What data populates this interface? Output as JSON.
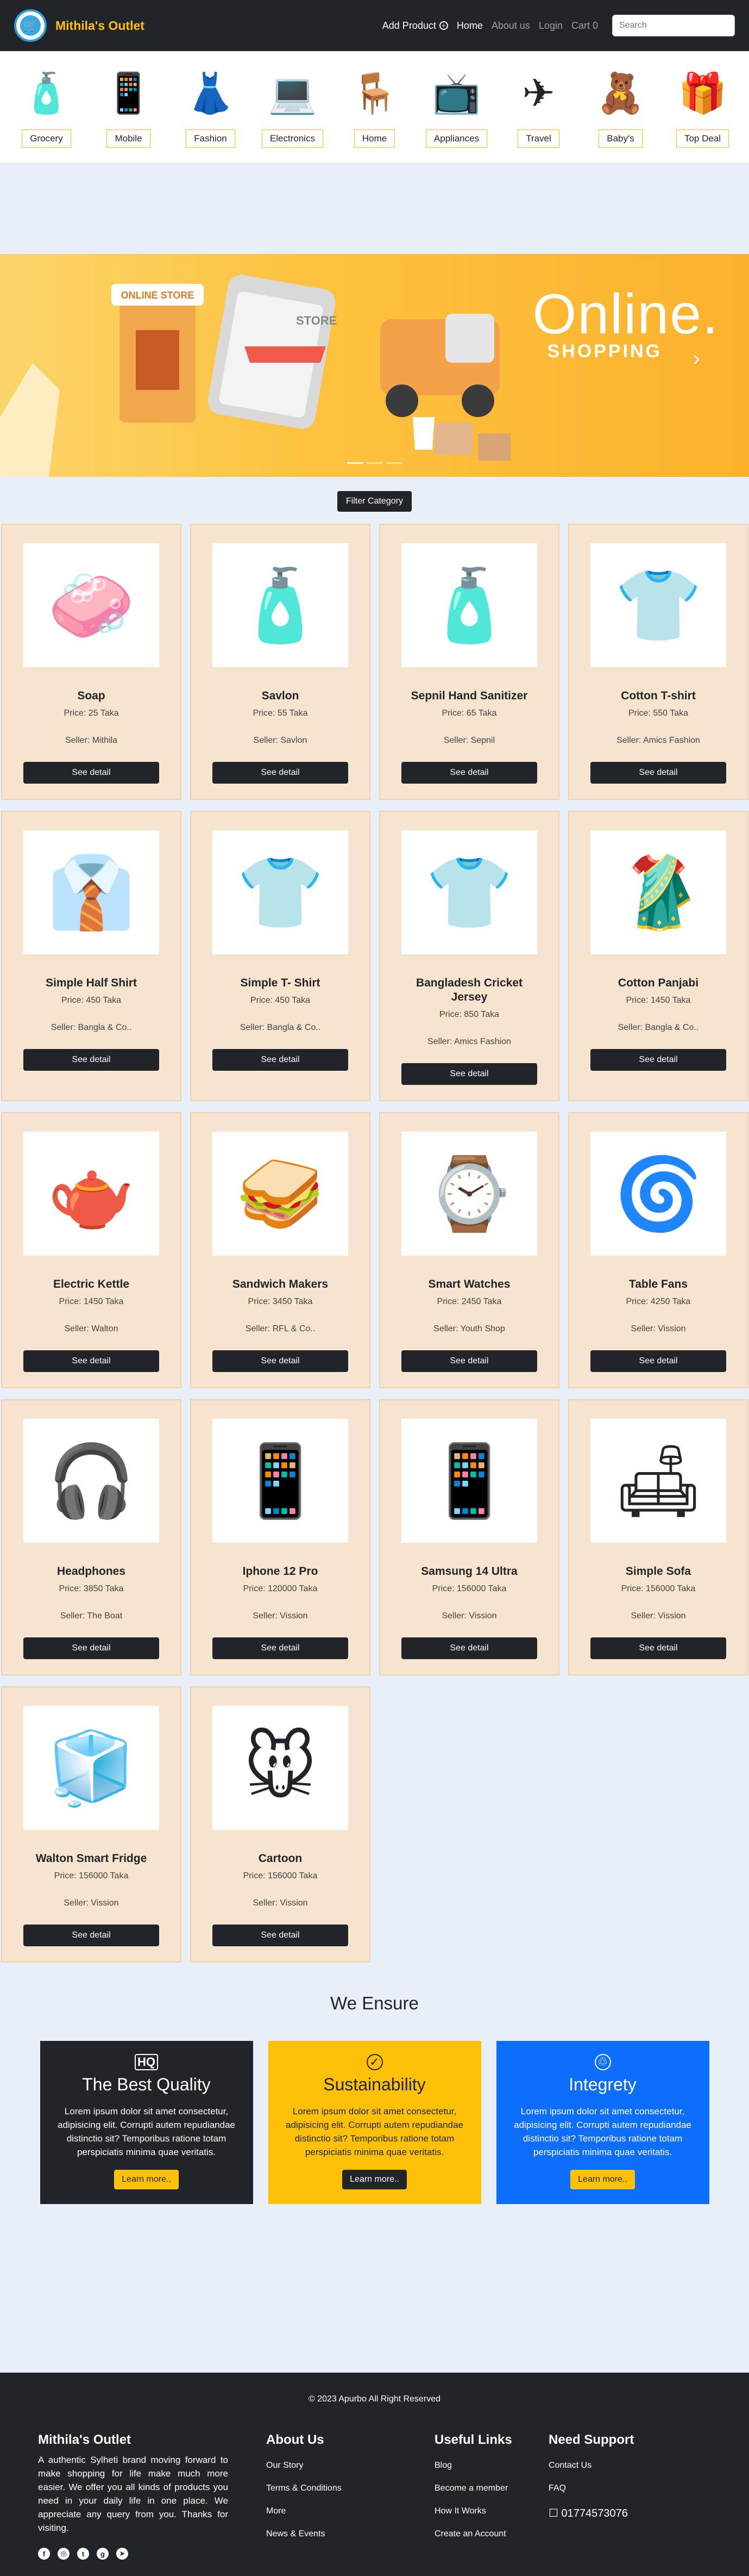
{
  "nav": {
    "brand": "Mithila's Outlet",
    "add_product": "Add Product",
    "links": [
      "Home",
      "About us",
      "Login"
    ],
    "cart": "Cart 0",
    "search_placeholder": "Search"
  },
  "categories": [
    "Grocery",
    "Mobile",
    "Fashion",
    "Electronics",
    "Home",
    "Appliances",
    "Travel",
    "Baby's",
    "Top Deal"
  ],
  "banner": {
    "title": "Online.",
    "subtitle": "SHOPPING",
    "store_sign": "ONLINE STORE",
    "store_sign2": "STORE"
  },
  "filter_label": "Filter Category",
  "products": [
    {
      "name": "Soap",
      "price": "Price: 25 Taka",
      "seller": "Seller: Mithila",
      "icon": "soap-icon"
    },
    {
      "name": "Savlon",
      "price": "Price: 55 Taka",
      "seller": "Seller: Savlon",
      "icon": "antiseptic-bottle-icon"
    },
    {
      "name": "Sepnil Hand Sanitizer",
      "price": "Price: 65 Taka",
      "seller": "Seller: Sepnil",
      "icon": "sanitizer-icon"
    },
    {
      "name": "Cotton T-shirt",
      "price": "Price: 550 Taka",
      "seller": "Seller: Amics Fashion",
      "icon": "tshirt-icon"
    },
    {
      "name": "Simple Half Shirt",
      "price": "Price: 450 Taka",
      "seller": "Seller: Bangla & Co..",
      "icon": "shirt-icon"
    },
    {
      "name": "Simple T- Shirt",
      "price": "Price: 450 Taka",
      "seller": "Seller: Bangla & Co..",
      "icon": "tshirt-icon"
    },
    {
      "name": "Bangladesh Cricket Jersey",
      "price": "Price: 850 Taka",
      "seller": "Seller: Amics Fashion",
      "icon": "jersey-icon"
    },
    {
      "name": "Cotton Panjabi",
      "price": "Price: 1450 Taka",
      "seller": "Seller: Bangla & Co..",
      "icon": "panjabi-icon"
    },
    {
      "name": "Electric Kettle",
      "price": "Price: 1450 Taka",
      "seller": "Seller: Walton",
      "icon": "kettle-icon"
    },
    {
      "name": "Sandwich Makers",
      "price": "Price: 3450 Taka",
      "seller": "Seller: RFL & Co..",
      "icon": "sandwich-maker-icon"
    },
    {
      "name": "Smart Watches",
      "price": "Price: 2450 Taka",
      "seller": "Seller: Youth Shop",
      "icon": "watch-icon"
    },
    {
      "name": "Table Fans",
      "price": "Price: 4250 Taka",
      "seller": "Seller: Vission",
      "icon": "fan-icon"
    },
    {
      "name": "Headphones",
      "price": "Price: 3850 Taka",
      "seller": "Seller: The Boat",
      "icon": "headphones-icon"
    },
    {
      "name": "Iphone 12 Pro",
      "price": "Price: 120000 Taka",
      "seller": "Seller: Vission",
      "icon": "phone-icon"
    },
    {
      "name": "Samsung 14 Ultra",
      "price": "Price: 156000 Taka",
      "seller": "Seller: Vission",
      "icon": "phone-icon"
    },
    {
      "name": "Simple Sofa",
      "price": "Price: 156000 Taka",
      "seller": "Seller: Vission",
      "icon": "sofa-icon"
    },
    {
      "name": "Walton Smart Fridge",
      "price": "Price: 156000 Taka",
      "seller": "Seller: Vission",
      "icon": "fridge-icon"
    },
    {
      "name": "Cartoon",
      "price": "Price: 156000 Taka",
      "seller": "Seller: Vission",
      "icon": "cartoon-icon"
    }
  ],
  "detail_label": "See detail",
  "ensure": {
    "title": "We Ensure",
    "cards": [
      {
        "title": "The Best Quality",
        "text": "Lorem ipsum dolor sit amet consectetur, adipisicing elit. Corrupti autem repudiandae distinctio sit? Temporibus ratione totam perspiciatis minima quae veritatis.",
        "button": "Learn more..",
        "icon": "hq-icon",
        "bg": "#212529",
        "fg": "#ffffff",
        "btn_bg": "#ffc107",
        "btn_fg": "#212529"
      },
      {
        "title": "Sustainability",
        "text": "Lorem ipsum dolor sit amet consectetur, adipisicing elit. Corrupti autem repudiandae distinctio sit? Temporibus ratione totam perspiciatis minima quae veritatis.",
        "button": "Learn more..",
        "icon": "check-circle-icon",
        "bg": "#ffc107",
        "fg": "#212529",
        "btn_bg": "#212529",
        "btn_fg": "#ffffff"
      },
      {
        "title": "Integrety",
        "text": "Lorem ipsum dolor sit amet consectetur, adipisicing elit. Corrupti autem repudiandae distinctio sit? Temporibus ratione totam perspiciatis minima quae veritatis.",
        "button": "Learn more..",
        "icon": "recycle-icon",
        "bg": "#0d6efd",
        "fg": "#ffffff",
        "btn_bg": "#ffc107",
        "btn_fg": "#212529"
      }
    ]
  },
  "footer": {
    "copyright": "© 2023 Apurbo All Right Reserved",
    "brand": "Mithila's Outlet",
    "about": "A authentic Sylheti brand moving forward to make shopping for life make much more easier. We offer you all kinds of products you need in your daily life in one place. We appreciate any query from you. Thanks for visiting.",
    "col1": {
      "title": "About Us",
      "links": [
        "Our Story",
        "Terms & Conditions",
        "More",
        "News & Events"
      ]
    },
    "col2": {
      "title": "Useful Links",
      "links": [
        "Blog",
        "Become a member",
        "How It Works",
        "Create an Account"
      ]
    },
    "col3": {
      "title": "Need Support",
      "links": [
        "Contact Us",
        "FAQ"
      ],
      "phone": "01774573076"
    },
    "socials": [
      "facebook-icon",
      "instagram-icon",
      "twitter-icon",
      "github-icon",
      "telegram-icon"
    ]
  },
  "colors": {
    "accent": "#ffc107",
    "dark": "#212529",
    "card_bg": "#f6e4ce",
    "primary": "#0d6efd"
  }
}
